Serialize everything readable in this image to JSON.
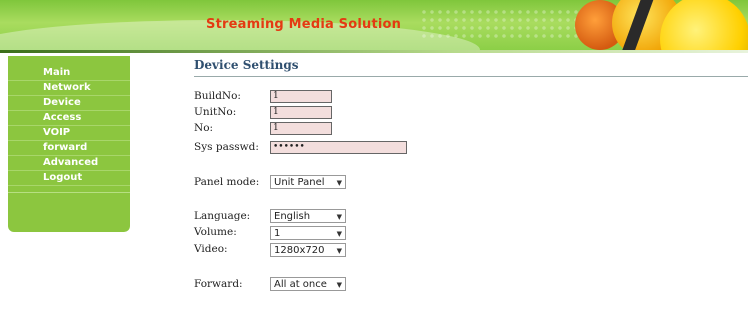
{
  "header": {
    "title": "Streaming Media Solution"
  },
  "sidebar": {
    "items": [
      {
        "label": "Main"
      },
      {
        "label": "Network"
      },
      {
        "label": "Device"
      },
      {
        "label": "Access"
      },
      {
        "label": "VOIP"
      },
      {
        "label": "forward"
      },
      {
        "label": "Advanced"
      },
      {
        "label": "Logout"
      }
    ]
  },
  "main": {
    "title": "Device Settings",
    "fields": {
      "build_no": {
        "label": "BuildNo:",
        "value": "1"
      },
      "unit_no": {
        "label": "UnitNo:",
        "value": "1"
      },
      "no": {
        "label": "No:",
        "value": "1"
      },
      "sys_passwd": {
        "label": "Sys passwd:",
        "value": "••••••"
      },
      "panel_mode": {
        "label": "Panel mode:",
        "value": "Unit Panel"
      },
      "language": {
        "label": "Language:",
        "value": "English"
      },
      "volume": {
        "label": "Volume:",
        "value": "1"
      },
      "video": {
        "label": "Video:",
        "value": "1280x720"
      },
      "forward": {
        "label": "Forward:",
        "value": "All at once"
      }
    }
  },
  "icons": {
    "dropdown": "chevron-down-icon"
  },
  "colors": {
    "accent": "#8cc63f",
    "title": "#e43a12",
    "input_bg": "#f3dedd"
  }
}
